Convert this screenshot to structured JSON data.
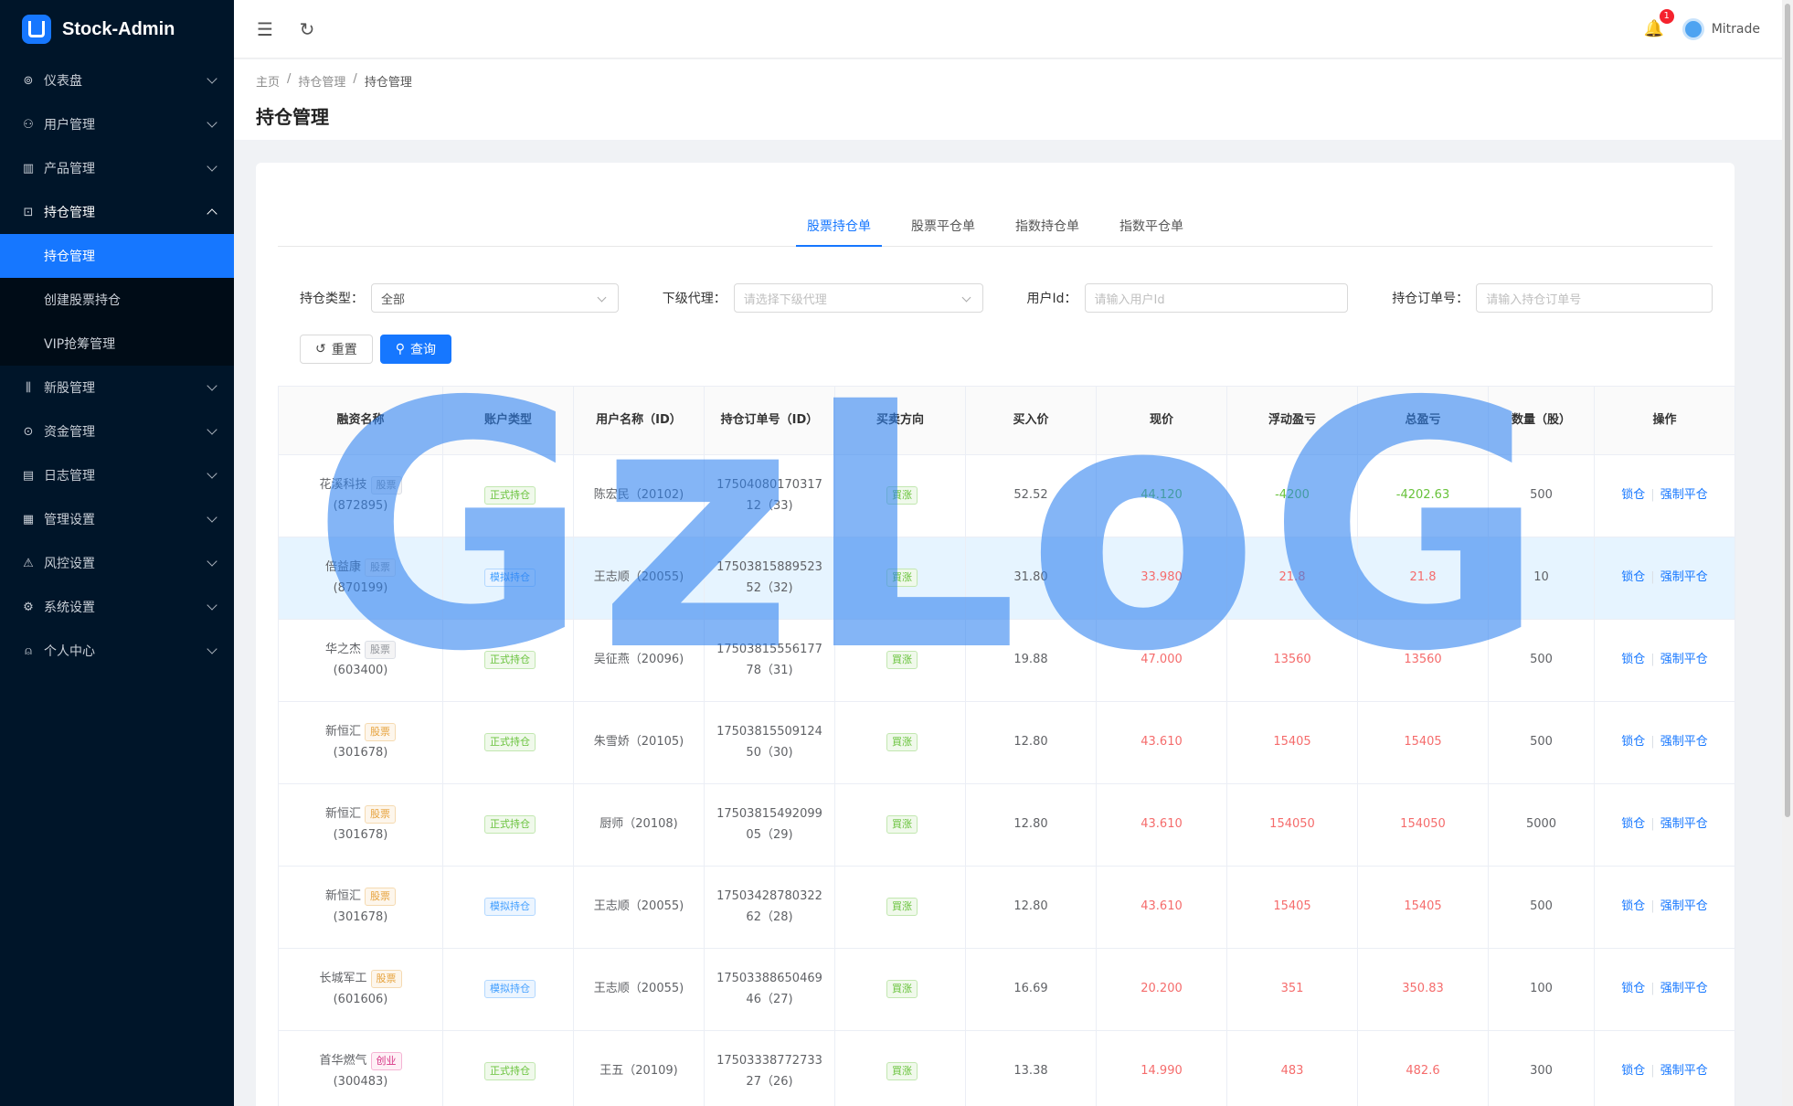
{
  "brand": {
    "title": "Stock-Admin"
  },
  "sidebar": {
    "items": [
      {
        "label": "仪表盘",
        "icon": "dashboard-icon"
      },
      {
        "label": "用户管理",
        "icon": "users-icon"
      },
      {
        "label": "产品管理",
        "icon": "chart-icon"
      },
      {
        "label": "持仓管理",
        "icon": "position-icon",
        "open": true,
        "children": [
          {
            "label": "持仓管理",
            "active": true
          },
          {
            "label": "创建股票持仓"
          },
          {
            "label": "VIP抢筹管理"
          }
        ]
      },
      {
        "label": "新股管理",
        "icon": "ipo-icon"
      },
      {
        "label": "资金管理",
        "icon": "money-icon"
      },
      {
        "label": "日志管理",
        "icon": "log-icon"
      },
      {
        "label": "管理设置",
        "icon": "admin-icon"
      },
      {
        "label": "风控设置",
        "icon": "warning-icon"
      },
      {
        "label": "系统设置",
        "icon": "gear-icon"
      },
      {
        "label": "个人中心",
        "icon": "user-icon"
      }
    ]
  },
  "header": {
    "badge": "1",
    "username": "Mitrade"
  },
  "breadcrumb": [
    "主页",
    "持仓管理",
    "持仓管理"
  ],
  "page_title": "持仓管理",
  "tabs": [
    "股票持仓单",
    "股票平仓单",
    "指数持仓单",
    "指数平仓单"
  ],
  "filters": {
    "type_label": "持仓类型：",
    "type_value": "全部",
    "agent_label": "下级代理：",
    "agent_placeholder": "请选择下级代理",
    "userid_label": "用户Id：",
    "userid_placeholder": "请输入用户Id",
    "order_label": "持仓订单号：",
    "order_placeholder": "请输入持仓订单号"
  },
  "buttons": {
    "reset": "重置",
    "query": "查询"
  },
  "table": {
    "headers": [
      "融资名称",
      "账户类型",
      "用户名称（ID）",
      "持仓订单号（ID）",
      "买卖方向",
      "买入价",
      "现价",
      "浮动盈亏",
      "总盈亏",
      "数量（股）",
      "操作"
    ],
    "rows": [
      {
        "name": "花溪科技",
        "tag": "股票",
        "tag_color": "gray",
        "code": "(872895)",
        "acct": "正式持仓",
        "acct_color": "green",
        "user": "陈宏民（20102)",
        "order1": "17504080170317",
        "order2": "12（33)",
        "dir": "買涨",
        "buy": "52.52",
        "now": "44.120",
        "float": "-4200",
        "total": "-4202.63",
        "qty": "500",
        "color": "green"
      },
      {
        "name": "倍益康",
        "tag": "股票",
        "tag_color": "gray",
        "code": "(870199)",
        "acct": "模拟持仓",
        "acct_color": "blue",
        "user": "王志顺（20055)",
        "order1": "17503815889523",
        "order2": "52（32)",
        "dir": "買涨",
        "buy": "31.80",
        "now": "33.980",
        "float": "21.8",
        "total": "21.8",
        "qty": "10",
        "color": "red",
        "hl": true
      },
      {
        "name": "华之杰",
        "tag": "股票",
        "tag_color": "gray",
        "code": "(603400)",
        "acct": "正式持仓",
        "acct_color": "green",
        "user": "吴征燕（20096)",
        "order1": "17503815556177",
        "order2": "78（31)",
        "dir": "買涨",
        "buy": "19.88",
        "now": "47.000",
        "float": "13560",
        "total": "13560",
        "qty": "500",
        "color": "red"
      },
      {
        "name": "新恒汇",
        "tag": "股票",
        "tag_color": "orange",
        "code": "(301678)",
        "acct": "正式持仓",
        "acct_color": "green",
        "user": "朱雪娇（20105)",
        "order1": "17503815509124",
        "order2": "50（30)",
        "dir": "買涨",
        "buy": "12.80",
        "now": "43.610",
        "float": "15405",
        "total": "15405",
        "qty": "500",
        "color": "red"
      },
      {
        "name": "新恒汇",
        "tag": "股票",
        "tag_color": "orange",
        "code": "(301678)",
        "acct": "正式持仓",
        "acct_color": "green",
        "user": "厨师（20108)",
        "order1": "17503815492099",
        "order2": "05（29)",
        "dir": "買涨",
        "buy": "12.80",
        "now": "43.610",
        "float": "154050",
        "total": "154050",
        "qty": "5000",
        "color": "red"
      },
      {
        "name": "新恒汇",
        "tag": "股票",
        "tag_color": "orange",
        "code": "(301678)",
        "acct": "模拟持仓",
        "acct_color": "blue",
        "user": "王志顺（20055)",
        "order1": "17503428780322",
        "order2": "62（28)",
        "dir": "買涨",
        "buy": "12.80",
        "now": "43.610",
        "float": "15405",
        "total": "15405",
        "qty": "500",
        "color": "red"
      },
      {
        "name": "长城军工",
        "tag": "股票",
        "tag_color": "orange",
        "code": "(601606)",
        "acct": "模拟持仓",
        "acct_color": "blue",
        "user": "王志顺（20055)",
        "order1": "17503388650469",
        "order2": "46（27)",
        "dir": "買涨",
        "buy": "16.69",
        "now": "20.200",
        "float": "351",
        "total": "350.83",
        "qty": "100",
        "color": "red"
      },
      {
        "name": "首华燃气",
        "tag": "创业",
        "tag_color": "pink",
        "code": "(300483)",
        "acct": "正式持仓",
        "acct_color": "green",
        "user": "王五（20109)",
        "order1": "17503338772733",
        "order2": "27（26)",
        "dir": "買涨",
        "buy": "13.38",
        "now": "14.990",
        "float": "483",
        "total": "482.6",
        "qty": "300",
        "color": "red"
      }
    ],
    "op_lock": "锁仓",
    "op_force": "强制平仓"
  },
  "watermark": "GzLoG"
}
